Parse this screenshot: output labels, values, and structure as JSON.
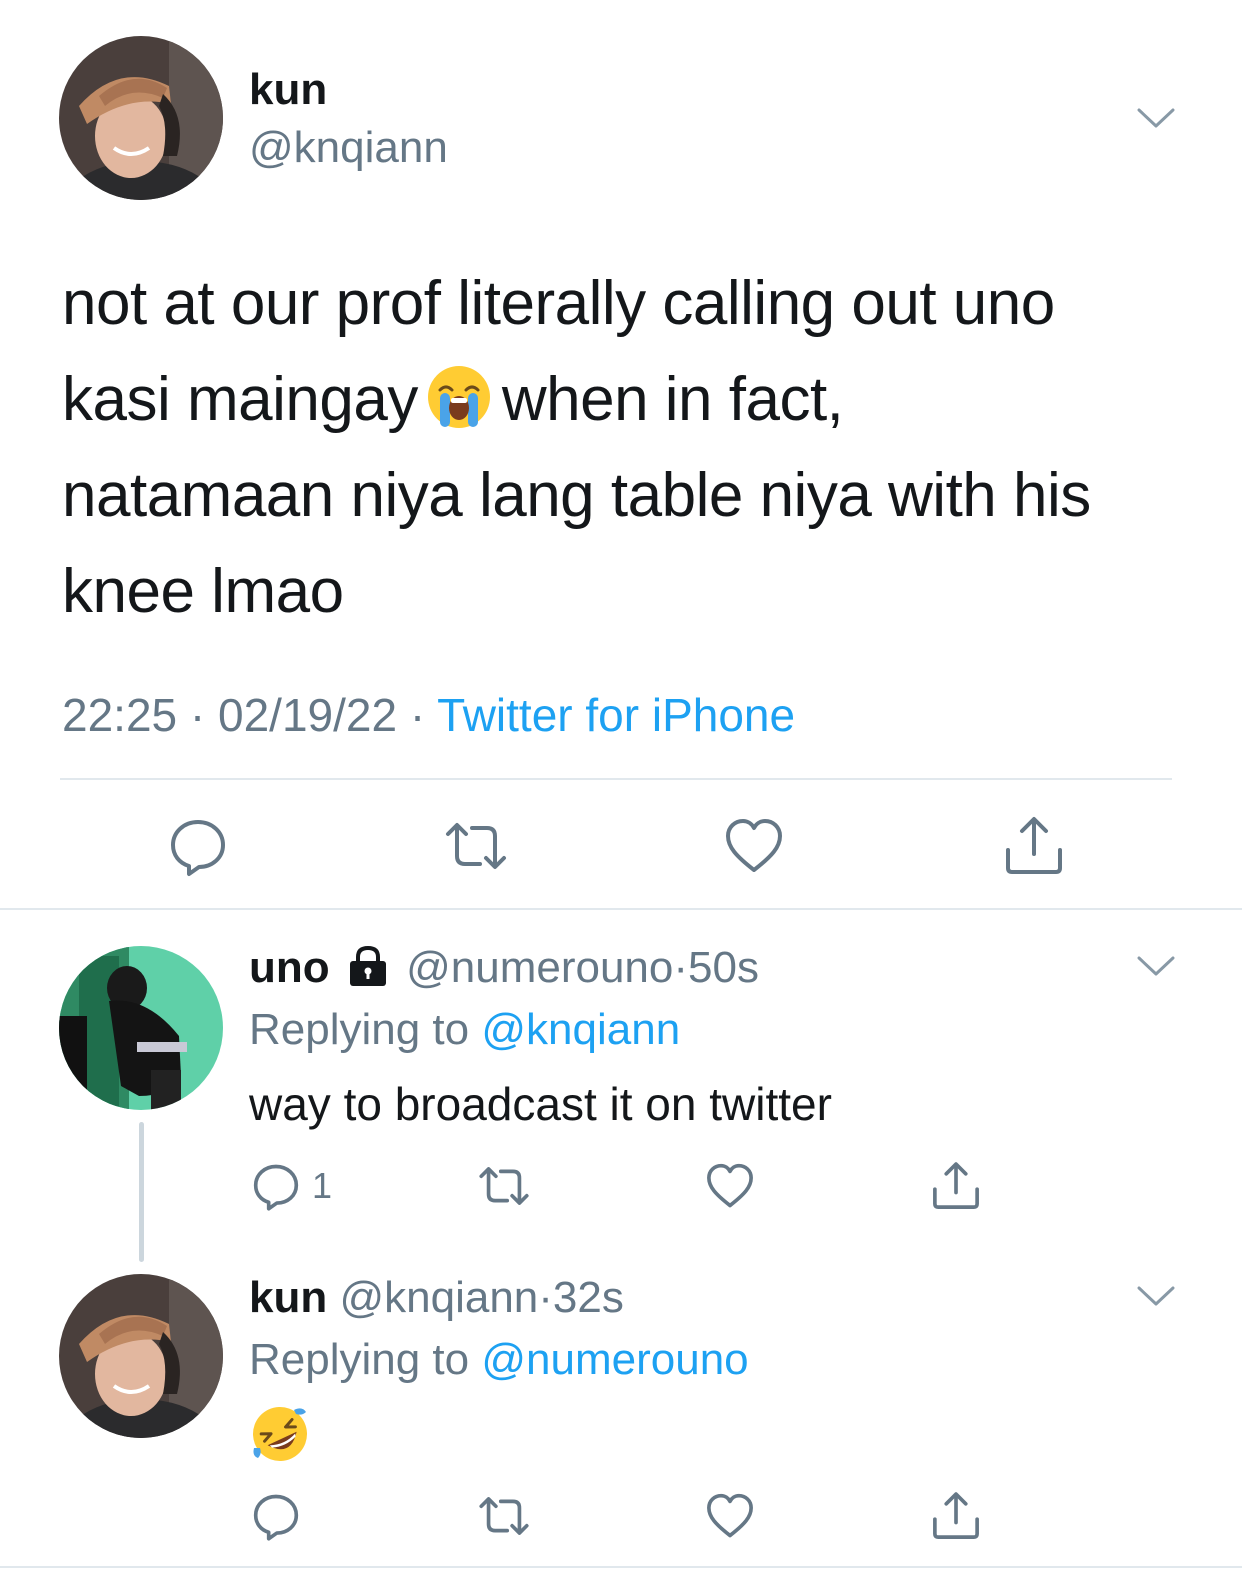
{
  "main_tweet": {
    "name": "kun",
    "handle": "@knqiann",
    "text_line1": "not at our prof literally calling out uno",
    "text_line2_a": "kasi maingay",
    "text_line2_b": "when in fact,",
    "text_line3": "natamaan niya lang table niya with his",
    "text_line4": "knee lmao",
    "inline_emoji": "loudly-crying-face-emoji",
    "time": "22:25",
    "date": "02/19/22",
    "separator": "·",
    "source": "Twitter for iPhone",
    "actions": [
      "reply-icon",
      "retweet-icon",
      "like-icon",
      "share-icon"
    ]
  },
  "replies": [
    {
      "name": "uno",
      "locked_icon": "lock-icon",
      "handle": "@numerouno",
      "separator": "·",
      "time": "50s",
      "replying_label": "Replying to",
      "replying_to": "@knqiann",
      "text": "way to broadcast it on twitter",
      "reply_count": "1"
    },
    {
      "name": "kun",
      "handle": "@knqiann",
      "separator": "·",
      "time": "32s",
      "replying_label": "Replying to",
      "replying_to": "@numerouno",
      "emoji": "rolling-on-the-floor-laughing-emoji"
    }
  ],
  "colors": {
    "text": "#14171a",
    "muted": "#657786",
    "link": "#1da1f2",
    "divider": "#e1e8ed"
  }
}
